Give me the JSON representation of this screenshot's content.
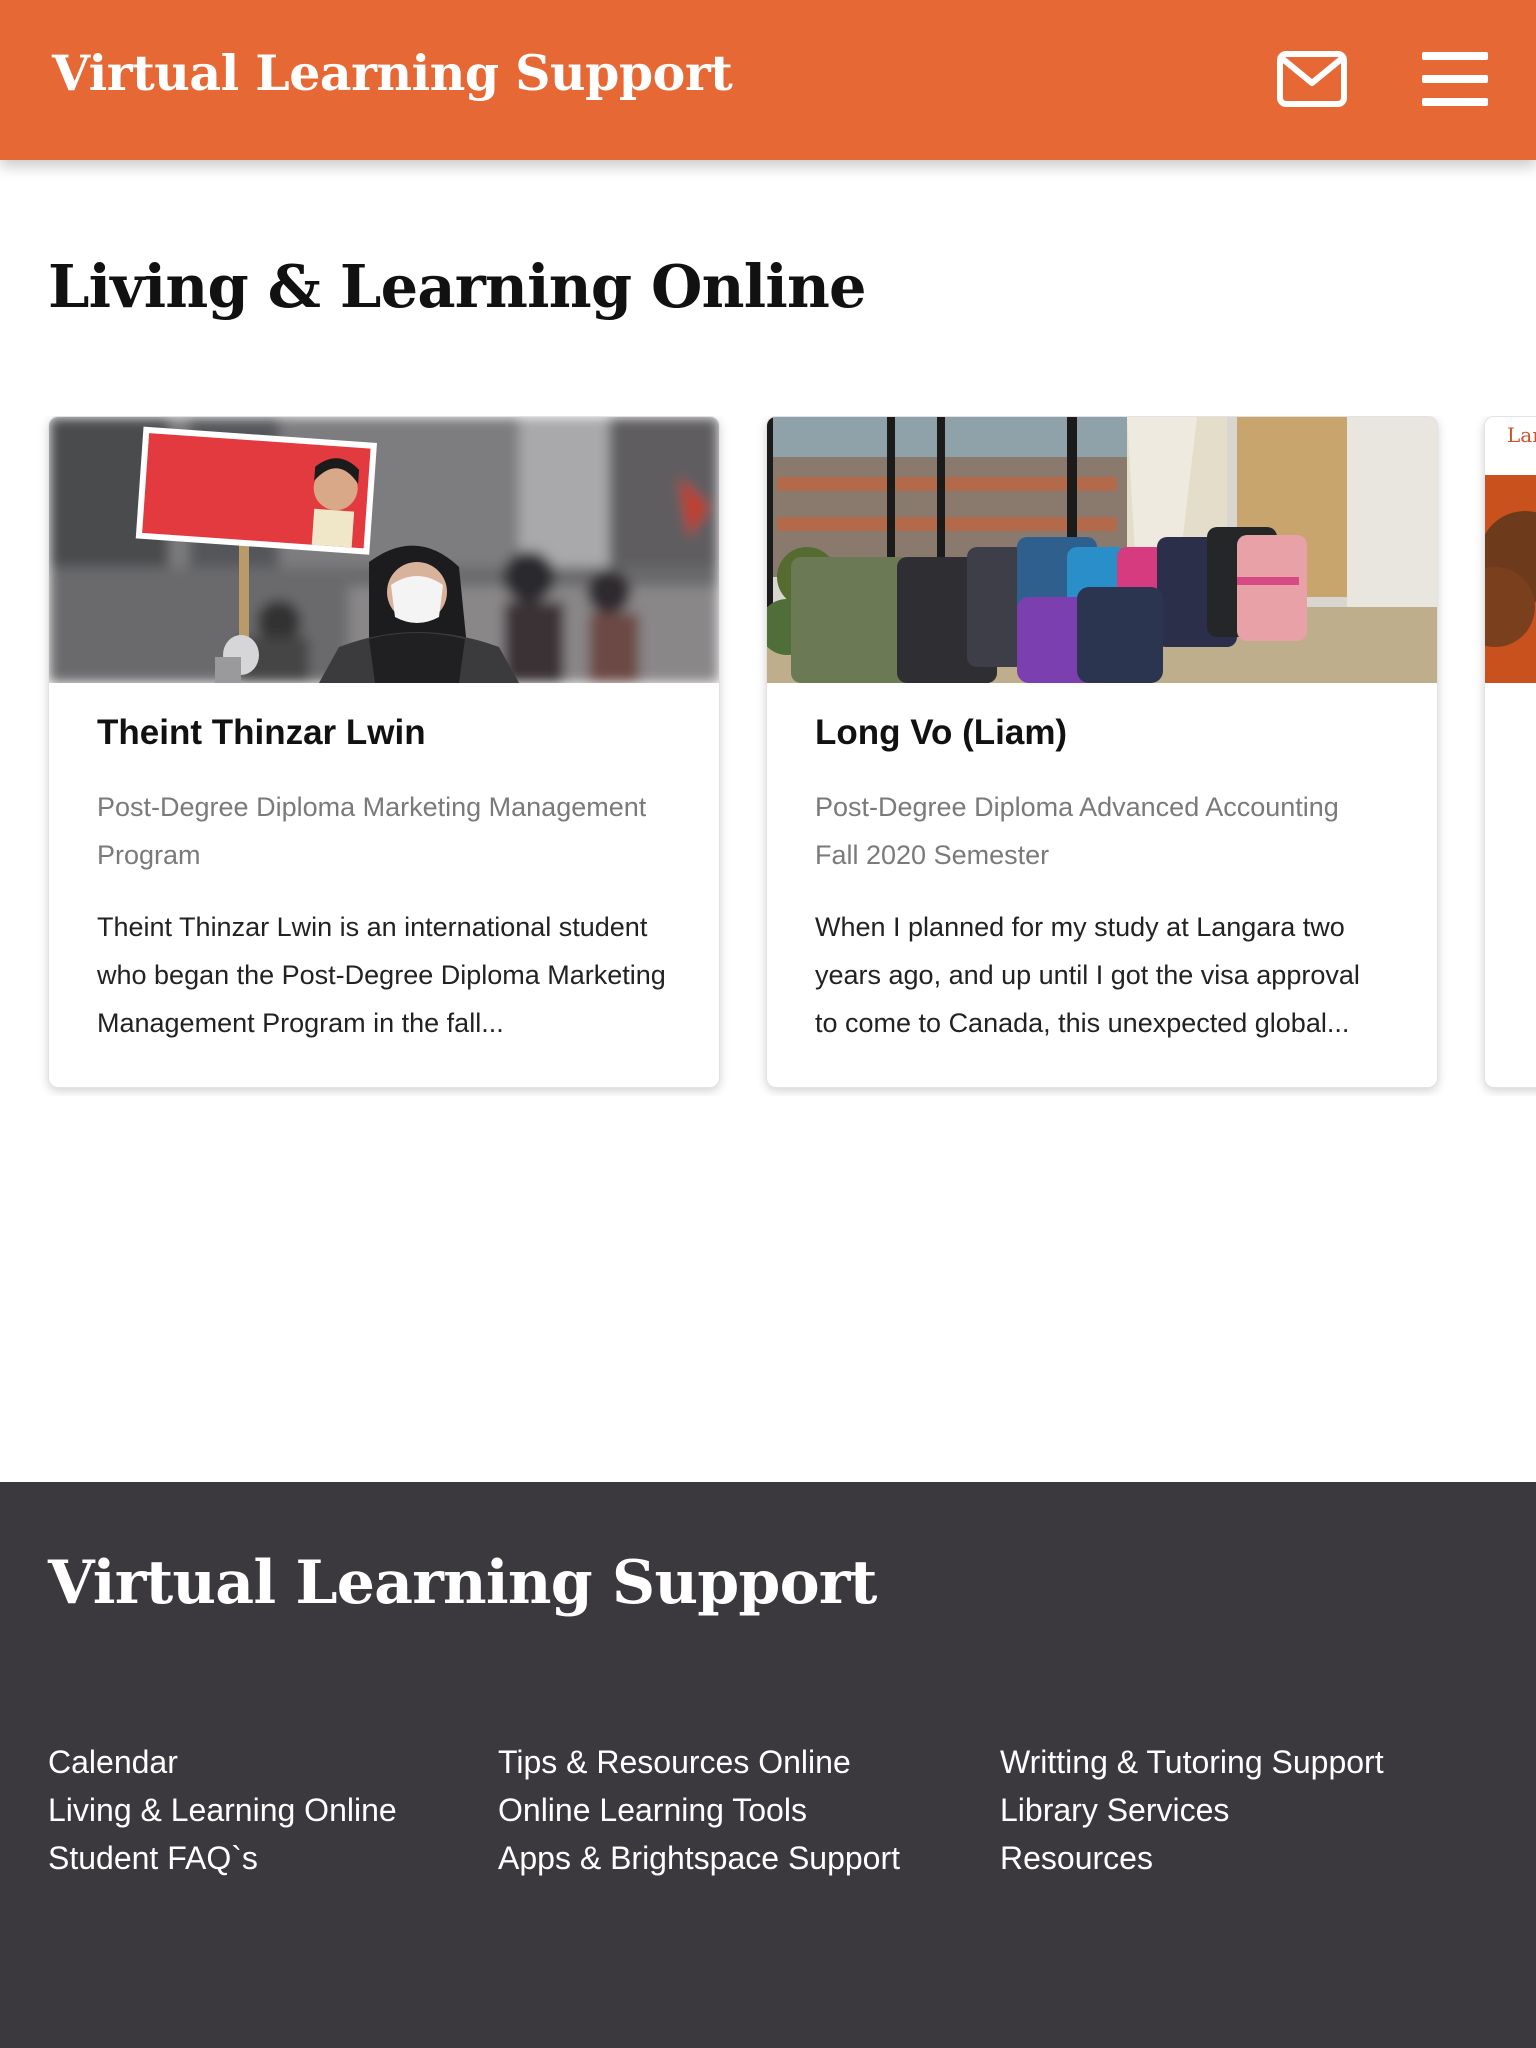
{
  "header": {
    "title": "Virtual Learning Support",
    "mail_icon": "mail-icon",
    "menu_icon": "hamburger-menu-icon",
    "background_color": "#e66834"
  },
  "main": {
    "title": "Living & Learning Online",
    "cards": [
      {
        "name": "Theint Thinzar Lwin",
        "program": "Post-Degree Diploma Marketing Management Program",
        "excerpt": "Theint Thinzar Lwin is an international student who began the Post-Degree Diploma Marketing Management Program in the fall..."
      },
      {
        "name": "Long Vo (Liam)",
        "program": "Post-Degree Diploma Advanced Accounting Fall 2020 Semester",
        "excerpt": "When I planned for my study at Langara two years ago, and up until I got the visa approval to come to Canada, this unexpected global..."
      },
      {
        "image_text": "Lar"
      }
    ]
  },
  "footer": {
    "title": "Virtual Learning Support",
    "background_color": "#3b393e",
    "columns": [
      [
        "Calendar",
        "Living & Learning Online",
        "Student FAQ`s"
      ],
      [
        "Tips & Resources Online",
        "Online Learning Tools",
        "Apps & Brightspace Support"
      ],
      [
        "Writting & Tutoring Support",
        "Library Services",
        "Resources"
      ]
    ]
  }
}
